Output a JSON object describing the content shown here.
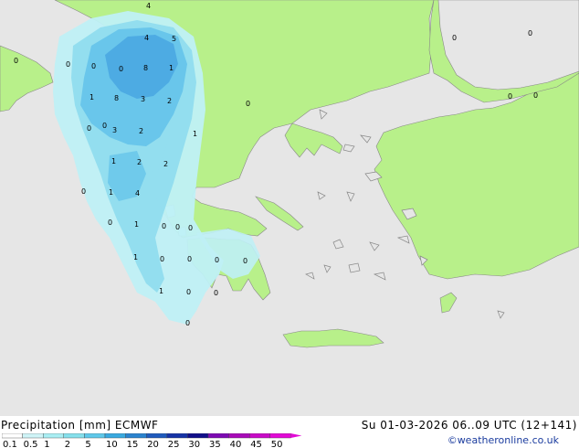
{
  "header": {
    "title_left": "Precipitation [mm]  ECMWF",
    "title_right": "Su 01-03-2026 06..09 UTC (12+141)",
    "credit": "©weatheronline.co.uk"
  },
  "legend": {
    "ticks": [
      "0.1",
      "0.5",
      "1",
      "2",
      "5",
      "10",
      "15",
      "20",
      "25",
      "30",
      "35",
      "40",
      "45",
      "50"
    ],
    "colors": [
      "#ffffff",
      "#cff4f7",
      "#a9eef3",
      "#86e0ec",
      "#5fc8ea",
      "#39a9e0",
      "#2a83cf",
      "#1f5bbd",
      "#1633a6",
      "#110f8a",
      "#7d0ab3",
      "#a80ab8",
      "#c80ac7",
      "#e20ad6"
    ]
  },
  "map": {
    "colors": {
      "sea": "#e6e6e6",
      "land": "#b8f08a",
      "precip_light": "#bff0f5",
      "precip_mid": "#90dcee",
      "precip_heavy": "#66c4ea",
      "precip_max": "#4aa7e2"
    },
    "values": [
      "4",
      "5",
      "0",
      "4",
      "8",
      "1",
      "0",
      "0",
      "1",
      "8",
      "3",
      "2",
      "0",
      "0",
      "3",
      "2",
      "1",
      "1",
      "2",
      "2",
      "0",
      "1",
      "4",
      "0",
      "1",
      "0",
      "0",
      "1",
      "0",
      "0",
      "0",
      "0",
      "1",
      "0",
      "0",
      "0",
      "0",
      "0",
      "0",
      "0",
      "0",
      "0",
      "0"
    ]
  }
}
